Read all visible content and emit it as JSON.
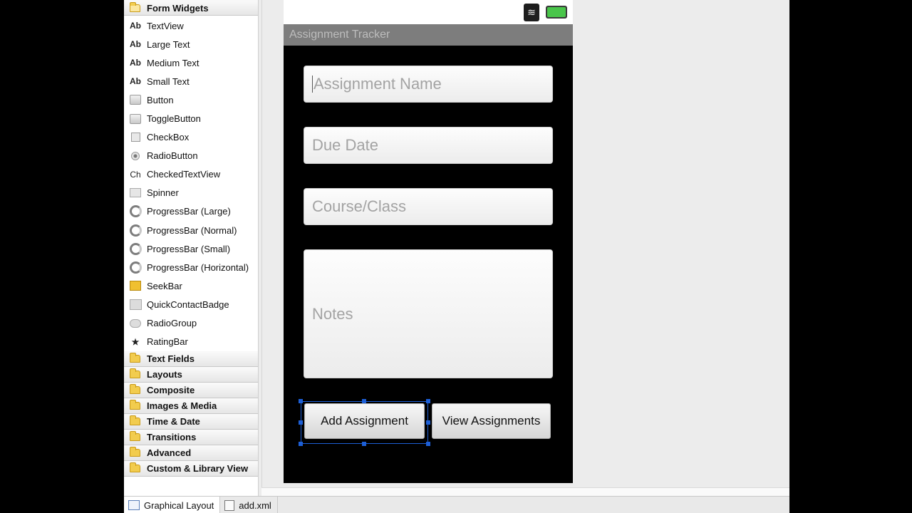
{
  "palette": {
    "form_widgets_label": "Form Widgets",
    "items": [
      {
        "label": "TextView",
        "icon": "Ab"
      },
      {
        "label": "Large Text",
        "icon": "Ab"
      },
      {
        "label": "Medium Text",
        "icon": "Ab"
      },
      {
        "label": "Small Text",
        "icon": "Ab"
      },
      {
        "label": "Button",
        "icon": "button-icon"
      },
      {
        "label": "ToggleButton",
        "icon": "toggle-button-icon"
      },
      {
        "label": "CheckBox",
        "icon": "checkbox-icon"
      },
      {
        "label": "RadioButton",
        "icon": "radio-button-icon"
      },
      {
        "label": "CheckedTextView",
        "icon": "Ch"
      },
      {
        "label": "Spinner",
        "icon": "spinner-icon"
      },
      {
        "label": "ProgressBar (Large)",
        "icon": "progress-icon"
      },
      {
        "label": "ProgressBar (Normal)",
        "icon": "progress-icon"
      },
      {
        "label": "ProgressBar (Small)",
        "icon": "progress-icon"
      },
      {
        "label": "ProgressBar (Horizontal)",
        "icon": "progress-icon"
      },
      {
        "label": "SeekBar",
        "icon": "seekbar-icon"
      },
      {
        "label": "QuickContactBadge",
        "icon": "contact-badge-icon"
      },
      {
        "label": "RadioGroup",
        "icon": "radio-group-icon"
      },
      {
        "label": "RatingBar",
        "icon": "star-icon"
      }
    ],
    "categories": [
      "Text Fields",
      "Layouts",
      "Composite",
      "Images & Media",
      "Time & Date",
      "Transitions",
      "Advanced",
      "Custom & Library View"
    ]
  },
  "device": {
    "app_title": "Assignment Tracker",
    "fields": {
      "assignment_name": "Assignment Name",
      "due_date": "Due Date",
      "course": "Course/Class",
      "notes": "Notes"
    },
    "buttons": {
      "add": "Add Assignment",
      "view": "View Assignments"
    }
  },
  "tabs": {
    "graphical_layout": "Graphical Layout",
    "xml": "add.xml"
  },
  "colors": {
    "selection": "#1d5fd6",
    "title_bar": "#7d7d7d",
    "battery": "#49c54a"
  }
}
